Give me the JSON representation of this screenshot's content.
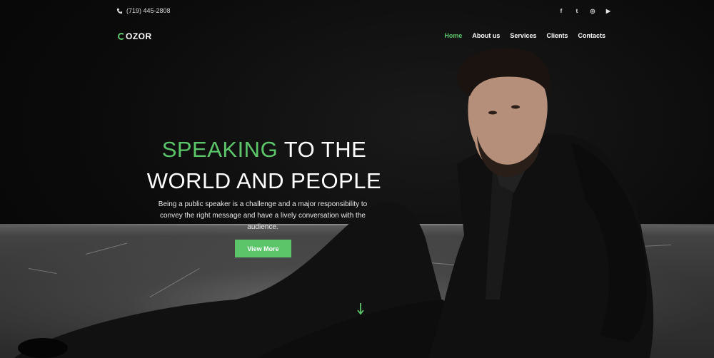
{
  "topbar": {
    "phone": "(719) 445-2808",
    "socials": [
      {
        "icon": "facebook-icon",
        "glyph": "f"
      },
      {
        "icon": "twitter-icon",
        "glyph": "t"
      },
      {
        "icon": "instagram-icon",
        "glyph": "◎"
      },
      {
        "icon": "youtube-icon",
        "glyph": "▶"
      }
    ]
  },
  "brand": {
    "logo_text": "OZOR"
  },
  "nav": {
    "items": [
      "Home",
      "About us",
      "Services",
      "Clients",
      "Contacts"
    ],
    "active": "Home"
  },
  "hero": {
    "headline_highlight": "SPEAKING",
    "headline_rest_line1": " TO THE",
    "headline_line2": "WORLD AND PEOPLE",
    "description": "Being a public speaker is a challenge and a major responsibility to convey the right message and have a lively conversation with the audience.",
    "cta_label": "View More"
  },
  "colors": {
    "accent": "#5cc56a",
    "background": "#0b0b0b",
    "text": "#ffffff"
  }
}
